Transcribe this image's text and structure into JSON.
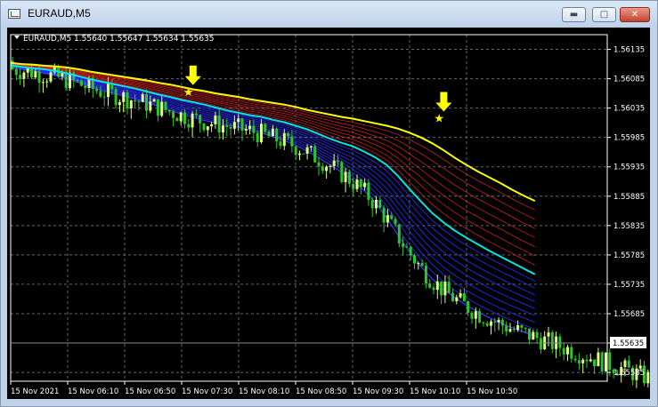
{
  "window": {
    "title": "EURAUD,M5",
    "minimize_icon": "minimize-icon",
    "maximize_icon": "maximize-icon",
    "close_icon": "close-icon"
  },
  "chart_header": {
    "text": "EURAUD,M5  1.55640 1.55647 1.55634 1.55635"
  },
  "price_axis": {
    "labels": [
      "1.56135",
      "1.56085",
      "1.56035",
      "1.55985",
      "1.55935",
      "1.55885",
      "1.55835",
      "1.55785",
      "1.55735",
      "1.55685",
      "1.55635",
      "1.55585"
    ],
    "current_price": "1.55635"
  },
  "time_axis": {
    "labels": [
      "15 Nov 2021",
      "15 Nov 06:10",
      "15 Nov 06:50",
      "15 Nov 07:30",
      "15 Nov 08:10",
      "15 Nov 08:50",
      "15 Nov 09:30",
      "15 Nov 10:10",
      "15 Nov 10:50"
    ]
  },
  "colors": {
    "background": "#000000",
    "grid": "#5a6a6a",
    "bull_candle": "#d8ff80",
    "bear_candle": "#2bc62b",
    "yellow_line": "#ffff00",
    "cyan_line": "#00e6e6",
    "red_band": "#c82020",
    "blue_band": "#2a2aff",
    "arrow": "#ffff00",
    "axis_text": "#ffffff"
  },
  "chart_data": {
    "type": "line",
    "symbol": "EURAUD",
    "timeframe": "M5",
    "ohlc_last": {
      "open": 1.5564,
      "high": 1.55647,
      "low": 1.55634,
      "close": 1.55635
    },
    "ylim": [
      1.5557,
      1.5616
    ],
    "x_time_start": "05:30",
    "bar_minutes": 5,
    "series": [
      {
        "values": [
          1.56112,
          1.5611,
          1.56109,
          1.56107,
          1.56106,
          1.56104,
          1.56101,
          1.56097,
          1.56094,
          1.56091,
          1.56088,
          1.56085,
          1.56082,
          1.56078,
          1.56075,
          1.56071,
          1.56067,
          1.56064,
          1.5606,
          1.56057,
          1.56054,
          1.5605,
          1.56047,
          1.56044,
          1.56041,
          1.56037,
          1.56032,
          1.56028,
          1.56024,
          1.5602,
          1.56017,
          1.56013,
          1.56009,
          1.56005,
          1.56,
          1.55993,
          1.55985,
          1.55975,
          1.55963,
          1.5595,
          1.55938,
          1.55927,
          1.55917,
          1.55907,
          1.55896,
          1.55886,
          1.55877
        ]
      },
      {
        "values": [
          1.56108,
          1.56105,
          1.56103,
          1.56101,
          1.56098,
          1.56094,
          1.56089,
          1.56084,
          1.5608,
          1.56076,
          1.56072,
          1.56068,
          1.56063,
          1.56058,
          1.56054,
          1.56049,
          1.56045,
          1.56041,
          1.56036,
          1.56031,
          1.56027,
          1.56023,
          1.5602,
          1.56015,
          1.56011,
          1.56005,
          1.55999,
          1.55991,
          1.55983,
          1.55976,
          1.5597,
          1.55961,
          1.55951,
          1.55938,
          1.55919,
          1.55897,
          1.55876,
          1.55856,
          1.5584,
          1.55826,
          1.55814,
          1.55803,
          1.55792,
          1.55782,
          1.55772,
          1.55762,
          1.55752
        ]
      },
      {
        "values": [
          1.56104,
          1.56101,
          1.56098,
          1.56094,
          1.5609,
          1.56085,
          1.56078,
          1.56071,
          1.56065,
          1.5606,
          1.56055,
          1.5605,
          1.56044,
          1.56038,
          1.56031,
          1.56025,
          1.56019,
          1.56014,
          1.5601,
          1.56006,
          1.56002,
          1.55998,
          1.55993,
          1.55986,
          1.5598,
          1.55972,
          1.55962,
          1.55951,
          1.55939,
          1.55926,
          1.55912,
          1.55895,
          1.55874,
          1.55848,
          1.55818,
          1.5579,
          1.55765,
          1.55744,
          1.55726,
          1.55712,
          1.55699,
          1.55688,
          1.55678,
          1.55669,
          1.55661,
          1.55654,
          1.55647
        ]
      }
    ],
    "arrows": [
      {
        "x": "06:50",
        "y": 1.56065
      },
      {
        "x": "08:40",
        "y": 1.5602
      }
    ],
    "xlabel": "",
    "ylabel": ""
  }
}
